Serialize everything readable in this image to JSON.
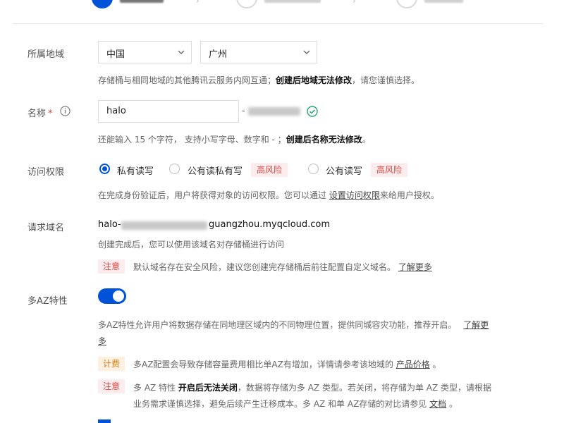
{
  "region": {
    "label": "所属地域",
    "country": "中国",
    "city": "广州",
    "help_prefix": "存储桶与相同地域的其他腾讯云服务内网互通；",
    "help_bold": "创建后地域无法修改",
    "help_suffix": "，请您谨慎选择。"
  },
  "name": {
    "label": "名称",
    "required_mark": "*",
    "value": "halo",
    "separator": "-",
    "help_prefix": "还能输入 15 个字符， 支持小写字母、数字和 - ；",
    "help_bold": "创建后名称无法修改",
    "help_suffix": "。"
  },
  "access": {
    "label": "访问权限",
    "options": [
      {
        "label": "私有读写",
        "checked": true,
        "risk": ""
      },
      {
        "label": "公有读私有写",
        "checked": false,
        "risk": "高风险"
      },
      {
        "label": "公有读写",
        "checked": false,
        "risk": "高风险"
      }
    ],
    "help_prefix": "在完成身份验证后，用户将获得对象的访问权限。您可以通过",
    "help_link": "设置访问权限",
    "help_suffix": "来给用户授权。"
  },
  "domain": {
    "label": "请求域名",
    "prefix": "halo-",
    "suffix": "guangzhou.myqcloud.com",
    "help": "创建完成后，您可以使用该域名对存储桶进行访问",
    "notice_tag": "注意",
    "notice_text": "默认域名存在安全风险，建议您创建完存储桶后前往配置自定义域名。",
    "notice_link": "了解更多"
  },
  "multi_az": {
    "label": "多AZ特性",
    "enabled": true,
    "help": "多AZ特性允许用户将数据存储在同地理区域内的不同物理位置，提供同城容灾功能，推荐开启。",
    "help_link_a": "了解更",
    "help_link_b": "多",
    "fee_tag": "计费",
    "fee_text": "多AZ配置会导致存储容量费用相比单AZ有增加，详情请参考该地域的",
    "fee_link": "产品价格",
    "fee_suffix": "。",
    "notice_tag": "注意",
    "notice_pre": "多 AZ 特性",
    "notice_bold": "开启后无法关闭",
    "notice_post": "，数据将存储为多 AZ 类型。若关闭，将存储为单 AZ 类型，请根据",
    "notice_line2": "业务需求谨慎选择，避免后续产生迁移成本。多 AZ 和单 AZ存储的对比请参见",
    "notice_link": "文档",
    "notice_end": "。"
  }
}
